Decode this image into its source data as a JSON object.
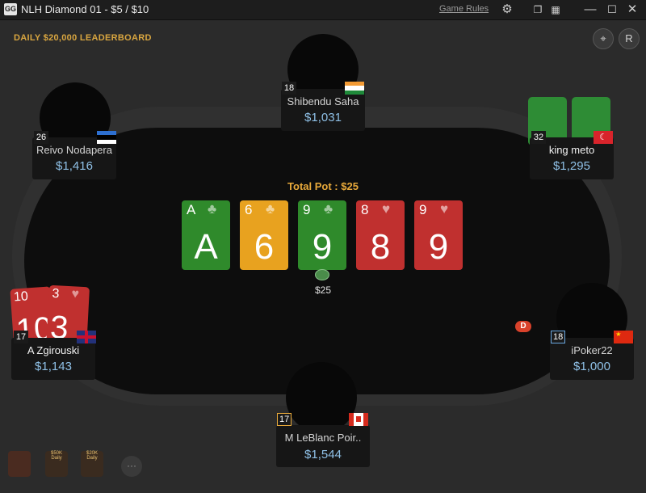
{
  "window": {
    "title": "NLH Diamond 01 - $5 / $10",
    "game_rules": "Game Rules",
    "app_icon": "GG",
    "icons": [
      "settings-icon",
      "tile-icon",
      "grid-icon",
      "minimize-icon",
      "maximize-icon",
      "close-icon"
    ]
  },
  "leaderboard": "DAILY $20,000 LEADERBOARD",
  "top_right": {
    "target_icon": "⌖",
    "replay_icon": "R"
  },
  "pot": {
    "total_label": "Total Pot : $25",
    "amount": "$25"
  },
  "board": [
    {
      "rank": "A",
      "suit": "♣",
      "color": "#2f8a2b"
    },
    {
      "rank": "6",
      "suit": "♣",
      "color": "#e8a21f"
    },
    {
      "rank": "9",
      "suit": "♣",
      "color": "#2f8a2b"
    },
    {
      "rank": "8",
      "suit": "♥",
      "color": "#c0302f"
    },
    {
      "rank": "9",
      "suit": "♥",
      "color": "#c0302f"
    }
  ],
  "dealer_button": "D",
  "players": [
    {
      "name": "Shibendu Saha",
      "stack": "$1,031",
      "level": "18",
      "flag": "india"
    },
    {
      "name": "Reivo Nodapera",
      "stack": "$1,416",
      "level": "26",
      "flag": "estonia"
    },
    {
      "name": "king meto",
      "stack": "$1,295",
      "level": "32",
      "flag": "turkey"
    },
    {
      "name": "A Zgirouski",
      "stack": "$1,143",
      "level": "17",
      "flag": "uk",
      "hole_cards": [
        {
          "rank": "10",
          "suit": "♥"
        },
        {
          "rank": "3",
          "suit": "♥"
        }
      ]
    },
    {
      "name": "iPoker22",
      "stack": "$1,000",
      "level": "18",
      "flag": "china"
    },
    {
      "name": "M LeBlanc Poir..",
      "stack": "$1,544",
      "level": "17",
      "flag": "canada"
    }
  ],
  "bottom_bar": {
    "badge_1": "$50K Daily",
    "badge_2": "$20K Daily",
    "more": "···"
  }
}
